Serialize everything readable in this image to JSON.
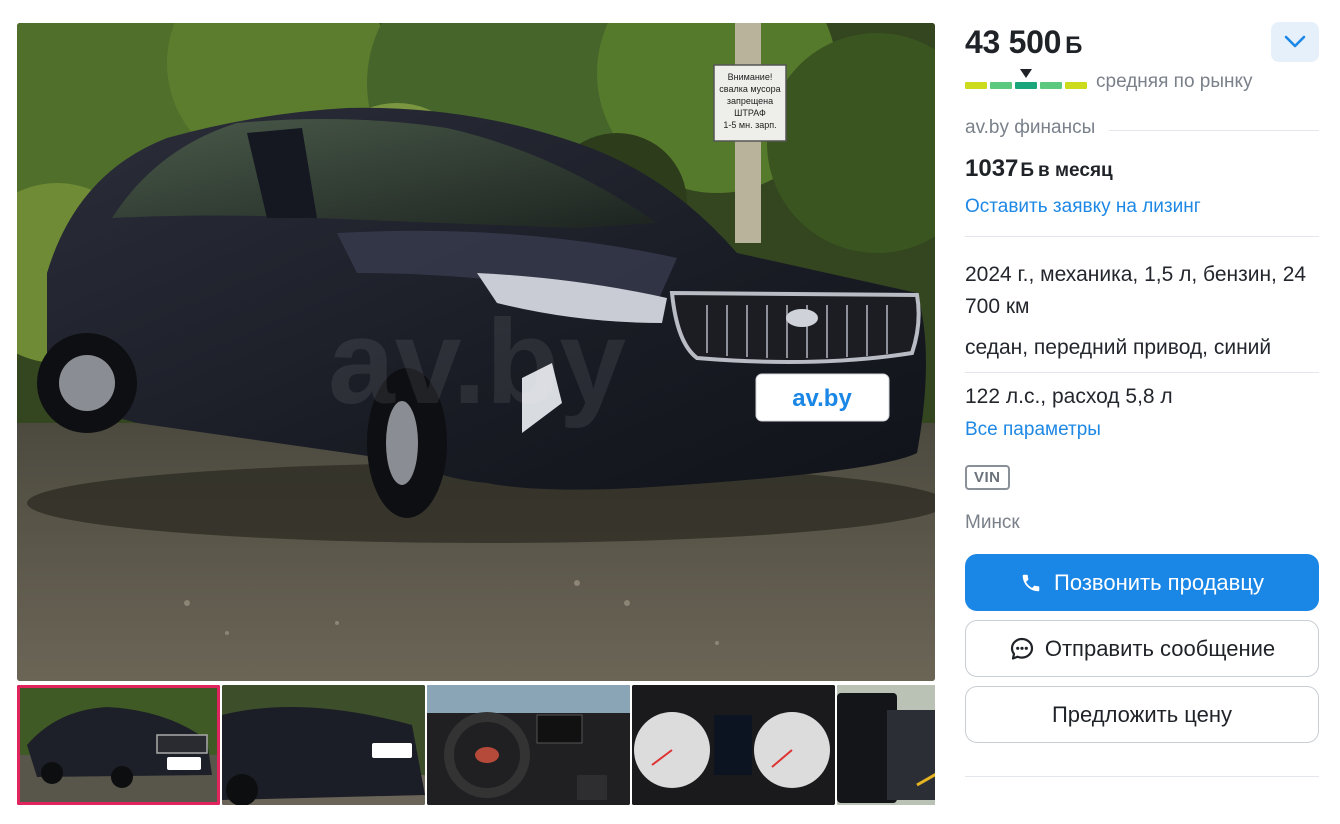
{
  "listing": {
    "price": "43 500",
    "currency": "Б",
    "price_rating_label": "средняя по рынку",
    "price_rating_segments": [
      "#cddb1d",
      "#5cc97f",
      "#1aa67a",
      "#5cc97f",
      "#cddb1d"
    ],
    "price_rating_position_index": 2
  },
  "finance": {
    "title": "av.by финансы",
    "monthly_amount": "1037",
    "currency": "Б",
    "monthly_suffix": "в месяц",
    "leasing_link": "Оставить заявку на лизинг"
  },
  "specs": {
    "line1": "2024 г., механика, 1,5 л, бензин, 24 700 км",
    "line2": "седан, передний привод, синий",
    "line3": "122 л.с., расход 5,8 л",
    "all_params_link": "Все параметры"
  },
  "vin_badge": "VIN",
  "city": "Минск",
  "actions": {
    "call": "Позвонить продавцу",
    "message": "Отправить сообщение",
    "offer": "Предложить цену"
  },
  "gallery": {
    "watermark": "av.by",
    "plate_text": "av.by",
    "sign_text": [
      "Внимание!",
      "свалка мусора",
      "запрещена",
      "ШТРАФ",
      "1-5 мн. зарп."
    ],
    "thumbnails": [
      {
        "kind": "car-front",
        "active": true
      },
      {
        "kind": "car-rear",
        "active": false
      },
      {
        "kind": "interior-wheel",
        "active": false
      },
      {
        "kind": "dashboard",
        "active": false
      },
      {
        "kind": "screen",
        "active": false
      }
    ]
  },
  "colors": {
    "accent_blue": "#1a87e6",
    "link_blue": "#1e88e5",
    "active_thumb_border": "#e0245e",
    "toggle_bg": "#e6f0fb"
  },
  "icons": {
    "expand": "chevron-down-icon",
    "call": "phone-icon",
    "message": "chat-bubble-icon"
  }
}
